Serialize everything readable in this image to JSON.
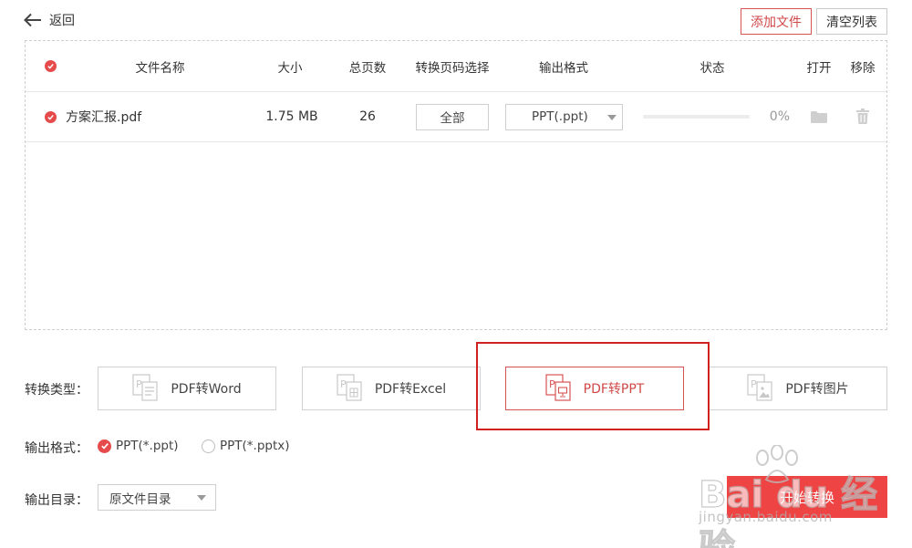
{
  "header": {
    "back_label": "返回",
    "add_file_label": "添加文件",
    "clear_list_label": "清空列表"
  },
  "table": {
    "columns": {
      "name": "文件名称",
      "size": "大小",
      "pages": "总页数",
      "page_select": "转换页码选择",
      "output_format": "输出格式",
      "status": "状态",
      "open": "打开",
      "remove": "移除"
    },
    "rows": [
      {
        "name": "方案汇报.pdf",
        "size": "1.75 MB",
        "pages": "26",
        "page_select": "全部",
        "output_format": "PPT(.ppt)",
        "progress_percent": 0,
        "progress_label": "0%"
      }
    ]
  },
  "conversion": {
    "type_label": "转换类型：",
    "types": [
      {
        "label": "PDF转Word",
        "icon": "pdf-to-word-icon"
      },
      {
        "label": "PDF转Excel",
        "icon": "pdf-to-excel-icon"
      },
      {
        "label": "PDF转PPT",
        "icon": "pdf-to-ppt-icon",
        "active": true
      },
      {
        "label": "PDF转图片",
        "icon": "pdf-to-image-icon"
      }
    ]
  },
  "output_format": {
    "label": "输出格式：",
    "options": [
      {
        "label": "PPT(*.ppt)",
        "selected": true
      },
      {
        "label": "PPT(*.pptx)",
        "selected": false
      }
    ]
  },
  "output_dir": {
    "label": "输出目录：",
    "value": "原文件目录"
  },
  "start_button_label": "开始转换",
  "watermark": {
    "brand": "Bai du 经验",
    "url": "jingyan.baidu.com"
  },
  "colors": {
    "accent": "#e64b4b",
    "highlight_box": "#d12020"
  }
}
